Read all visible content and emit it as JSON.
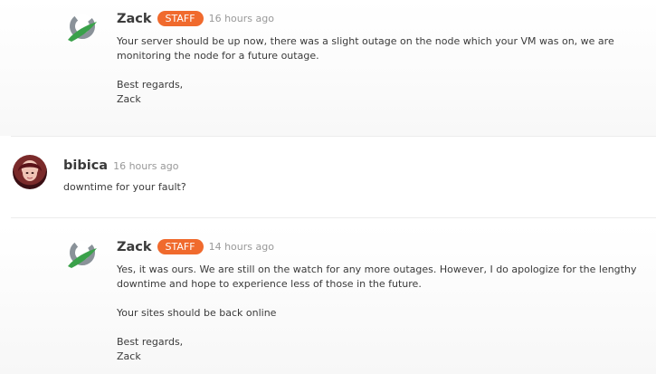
{
  "comments": [
    {
      "author": "Zack",
      "badge": "STAFF",
      "time": "16 hours ago",
      "lines": [
        "Your server should be up now, there was a slight outage on the node which your VM was on, we are monitoring the node for a future outage.",
        "Best regards,",
        "Zack"
      ]
    },
    {
      "author": "bibica",
      "time": "16 hours ago",
      "lines": [
        "downtime for your fault?"
      ]
    },
    {
      "author": "Zack",
      "badge": "STAFF",
      "time": "14 hours ago",
      "lines": [
        "Yes, it was ours. We are still on the watch for any more outages. However, I do apologize for the lengthy downtime and hope to experience less of those in the future.",
        "Your sites should be back online",
        "Best regards,",
        "Zack"
      ]
    }
  ],
  "colors": {
    "badge": "#f06a2d",
    "logo_green": "#3aa14a",
    "logo_gray": "#8a9299"
  },
  "icons": {
    "staff_avatar": "company-logo-icon",
    "user_avatar": "user-photo"
  }
}
